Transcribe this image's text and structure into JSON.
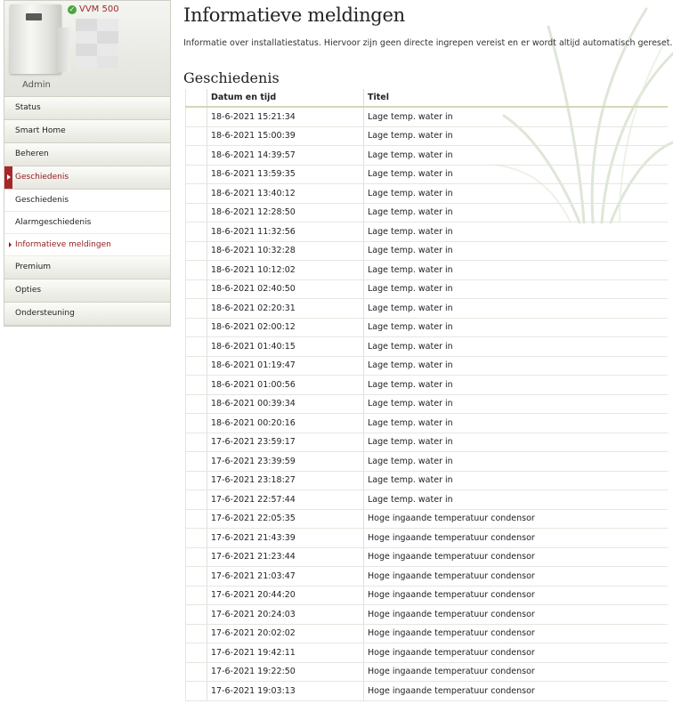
{
  "device": {
    "model": "VVM 500",
    "user": "Admin",
    "status_icon": "check-circle-icon"
  },
  "nav": {
    "items": [
      {
        "label": "Status"
      },
      {
        "label": "Smart Home"
      },
      {
        "label": "Beheren"
      },
      {
        "label": "Geschiedenis"
      }
    ],
    "subitems": [
      {
        "label": "Geschiedenis"
      },
      {
        "label": "Alarmgeschiedenis"
      },
      {
        "label": "Informatieve meldingen"
      }
    ],
    "bottom_items": [
      {
        "label": "Premium"
      },
      {
        "label": "Opties"
      },
      {
        "label": "Ondersteuning"
      }
    ]
  },
  "page": {
    "title": "Informatieve meldingen",
    "description": "Informatie over installatiestatus. Hiervoor zijn geen directe ingrepen vereist en er wordt altijd automatisch gereset.",
    "section_title": "Geschiedenis"
  },
  "table": {
    "headers": [
      "Datum en tijd",
      "Titel"
    ],
    "rows": [
      [
        "18-6-2021 15:21:34",
        "Lage temp. water in"
      ],
      [
        "18-6-2021 15:00:39",
        "Lage temp. water in"
      ],
      [
        "18-6-2021 14:39:57",
        "Lage temp. water in"
      ],
      [
        "18-6-2021 13:59:35",
        "Lage temp. water in"
      ],
      [
        "18-6-2021 13:40:12",
        "Lage temp. water in"
      ],
      [
        "18-6-2021 12:28:50",
        "Lage temp. water in"
      ],
      [
        "18-6-2021 11:32:56",
        "Lage temp. water in"
      ],
      [
        "18-6-2021 10:32:28",
        "Lage temp. water in"
      ],
      [
        "18-6-2021 10:12:02",
        "Lage temp. water in"
      ],
      [
        "18-6-2021 02:40:50",
        "Lage temp. water in"
      ],
      [
        "18-6-2021 02:20:31",
        "Lage temp. water in"
      ],
      [
        "18-6-2021 02:00:12",
        "Lage temp. water in"
      ],
      [
        "18-6-2021 01:40:15",
        "Lage temp. water in"
      ],
      [
        "18-6-2021 01:19:47",
        "Lage temp. water in"
      ],
      [
        "18-6-2021 01:00:56",
        "Lage temp. water in"
      ],
      [
        "18-6-2021 00:39:34",
        "Lage temp. water in"
      ],
      [
        "18-6-2021 00:20:16",
        "Lage temp. water in"
      ],
      [
        "17-6-2021 23:59:17",
        "Lage temp. water in"
      ],
      [
        "17-6-2021 23:39:59",
        "Lage temp. water in"
      ],
      [
        "17-6-2021 23:18:27",
        "Lage temp. water in"
      ],
      [
        "17-6-2021 22:57:44",
        "Lage temp. water in"
      ],
      [
        "17-6-2021 22:05:35",
        "Hoge ingaande temperatuur condensor"
      ],
      [
        "17-6-2021 21:43:39",
        "Hoge ingaande temperatuur condensor"
      ],
      [
        "17-6-2021 21:23:44",
        "Hoge ingaande temperatuur condensor"
      ],
      [
        "17-6-2021 21:03:47",
        "Hoge ingaande temperatuur condensor"
      ],
      [
        "17-6-2021 20:44:20",
        "Hoge ingaande temperatuur condensor"
      ],
      [
        "17-6-2021 20:24:03",
        "Hoge ingaande temperatuur condensor"
      ],
      [
        "17-6-2021 20:02:02",
        "Hoge ingaande temperatuur condensor"
      ],
      [
        "17-6-2021 19:42:11",
        "Hoge ingaande temperatuur condensor"
      ],
      [
        "17-6-2021 19:22:50",
        "Hoge ingaande temperatuur condensor"
      ],
      [
        "17-6-2021 19:03:13",
        "Hoge ingaande temperatuur condensor"
      ]
    ]
  },
  "colors": {
    "accent": "#a8262a",
    "link_active": "#8e1c1c",
    "ok": "#4aa63c"
  }
}
